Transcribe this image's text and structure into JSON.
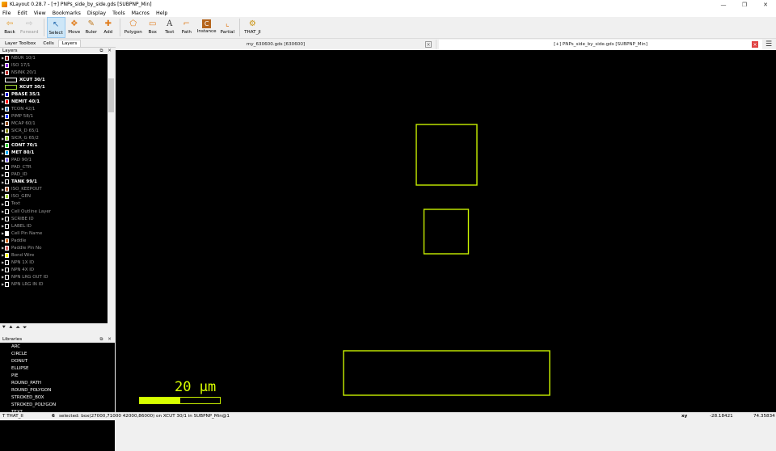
{
  "window": {
    "title": "KLayout 0.28.7 - [+] PNPs_side_by_side.gds [SUBPNP_Min]",
    "controls": [
      "—",
      "❐",
      "✕"
    ]
  },
  "menu": [
    "File",
    "Edit",
    "View",
    "Bookmarks",
    "Display",
    "Tools",
    "Macros",
    "Help"
  ],
  "toolbar": {
    "buttons": [
      {
        "id": "back",
        "label": "Back",
        "icon": "back-arrow-icon",
        "glyph": "⇦"
      },
      {
        "id": "forward",
        "label": "Forward",
        "icon": "forward-arrow-icon",
        "glyph": "⇨"
      },
      {
        "id": "select",
        "label": "Select",
        "icon": "select-cursor-icon",
        "glyph": "↖"
      },
      {
        "id": "move",
        "label": "Move",
        "icon": "move-icon",
        "glyph": "✥"
      },
      {
        "id": "ruler",
        "label": "Ruler",
        "icon": "ruler-icon",
        "glyph": "📏"
      },
      {
        "id": "add",
        "label": "Add",
        "icon": "add-icon",
        "glyph": "✚"
      },
      {
        "id": "polygon",
        "label": "Polygon",
        "icon": "polygon-icon",
        "glyph": "⬠"
      },
      {
        "id": "box",
        "label": "Box",
        "icon": "box-icon",
        "glyph": "▭"
      },
      {
        "id": "text",
        "label": "Text",
        "icon": "text-icon",
        "glyph": "A"
      },
      {
        "id": "path",
        "label": "Path",
        "icon": "path-icon",
        "glyph": "⌐"
      },
      {
        "id": "instance",
        "label": "Instance",
        "icon": "instance-icon",
        "glyph": "C"
      },
      {
        "id": "partial",
        "label": "Partial",
        "icon": "partial-icon",
        "glyph": "⌞"
      },
      {
        "id": "that_ji",
        "label": "THAT_JI",
        "icon": "gear-icon",
        "glyph": "⚙"
      }
    ]
  },
  "panel": {
    "tabs": [
      "Layer Toolbox",
      "Cells",
      "Layers"
    ],
    "active_tab": "Layers",
    "layers_title": "Layers",
    "libraries_title": "Libraries",
    "dock_buttons": "⧉ ✕"
  },
  "layers": [
    {
      "name": "NBUR 10/1",
      "color": "#8b1a1a",
      "visible": false
    },
    {
      "name": "ISO 17/1",
      "color": "#8a2be2",
      "visible": false
    },
    {
      "name": "NSINK 20/1",
      "color": "#b22222",
      "visible": false
    },
    {
      "name": "XCUT 30/1",
      "color": "#000000",
      "border": "#ffffff",
      "wide": true,
      "visible": true
    },
    {
      "name": "XCUT 30/1",
      "color": "#000000",
      "border": "#9acd32",
      "wide": true,
      "visible": true
    },
    {
      "name": "PBASE 35/1",
      "color": "#0000cd",
      "visible": true
    },
    {
      "name": "NEMIT 40/1",
      "color": "#ff0000",
      "visible": true
    },
    {
      "name": "TCON 42/1",
      "color": "#4682b4",
      "visible": false
    },
    {
      "name": "PIMP 58/1",
      "color": "#1e3cff",
      "visible": false
    },
    {
      "name": "MCAP 60/1",
      "color": "#8b4513",
      "visible": false
    },
    {
      "name": "SICR_D 65/1",
      "color": "#808000",
      "visible": false
    },
    {
      "name": "SICR_G 65/2",
      "color": "#9acd32",
      "visible": false
    },
    {
      "name": "CONT 70/1",
      "color": "#32cd32",
      "visible": true
    },
    {
      "name": "MET 80/1",
      "color": "#00aaff",
      "visible": true
    },
    {
      "name": "PAD 90/1",
      "color": "#7b68ee",
      "visible": false
    },
    {
      "name": "PAD_CTR",
      "color": "#000000",
      "visible": false
    },
    {
      "name": "PAD_ID",
      "color": "#000000",
      "visible": false
    },
    {
      "name": "TANK 99/1",
      "color": "#000000",
      "visible": true
    },
    {
      "name": "ISO_KEEPOUT",
      "color": "#a0522d",
      "visible": false
    },
    {
      "name": "ISO_GEN",
      "color": "#9acd32",
      "visible": false
    },
    {
      "name": "Text",
      "color": "#000000",
      "visible": false
    },
    {
      "name": "Cell Outline Layer",
      "color": "#000000",
      "visible": false
    },
    {
      "name": "SCRIBE ID",
      "color": "#000000",
      "visible": false
    },
    {
      "name": "LABEL ID",
      "color": "#000000",
      "visible": false
    },
    {
      "name": "Cell Pin Name",
      "color": "#ffffff",
      "visible": false
    },
    {
      "name": "Paddle",
      "color": "#d2691e",
      "visible": false
    },
    {
      "name": "Paddle Pin No",
      "color": "#cd5c5c",
      "visible": false
    },
    {
      "name": "Bond Wire",
      "color": "#ffff00",
      "visible": false
    },
    {
      "name": "NPN 1X ID",
      "color": "#000000",
      "visible": false
    },
    {
      "name": "NPN 4X ID",
      "color": "#000000",
      "visible": false
    },
    {
      "name": "NPN LRG OUT ID",
      "color": "#000000",
      "visible": false
    },
    {
      "name": "NPN LRG IN ID",
      "color": "#000000",
      "visible": false
    }
  ],
  "layer_buttons": [
    "⯆",
    "⯅",
    "⏶",
    "⏷"
  ],
  "libraries": [
    "ARC",
    "CIRCLE",
    "DONUT",
    "ELLIPSE",
    "PIE",
    "ROUND_PATH",
    "ROUND_POLYGON",
    "STROKED_BOX",
    "STROKED_POLYGON",
    "TEXT"
  ],
  "doc_tabs": [
    {
      "label": "my_630600.gds [630600]",
      "active": false
    },
    {
      "label": "[+] PNPs_side_by_side.gds [SUBPNP_Min]",
      "active": true
    }
  ],
  "canvas": {
    "scale_label": "20 µm",
    "scale_fill": 0.5,
    "shape_color": "#c8f000",
    "shapes": [
      {
        "layer": "XCUT 30/1",
        "kind": "box",
        "name": "upper-box"
      },
      {
        "layer": "XCUT 30/1",
        "kind": "box",
        "name": "middle-box"
      },
      {
        "layer": "XCUT 30/1",
        "kind": "box",
        "name": "lower-wide-box"
      }
    ]
  },
  "status": {
    "mode": "T THAT_II",
    "count": "6",
    "message": "selected: box(27000,71000 42000,86000) on XCUT 30/1 in SUBPNP_Min@1",
    "coord_label": "xy",
    "x": "-28.18421",
    "y": "74.35834"
  }
}
